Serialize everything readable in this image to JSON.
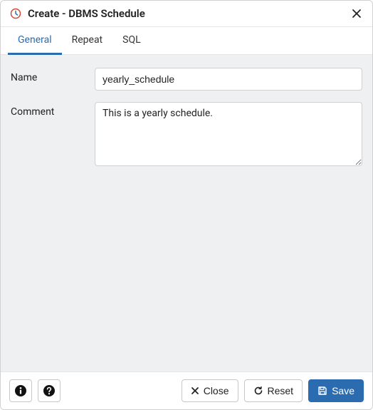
{
  "dialog": {
    "title": "Create - DBMS Schedule"
  },
  "tabs": {
    "general": "General",
    "repeat": "Repeat",
    "sql": "SQL"
  },
  "form": {
    "name_label": "Name",
    "name_value": "yearly_schedule",
    "comment_label": "Comment",
    "comment_value": "This is a yearly schedule."
  },
  "footer": {
    "close_label": "Close",
    "reset_label": "Reset",
    "save_label": "Save"
  }
}
